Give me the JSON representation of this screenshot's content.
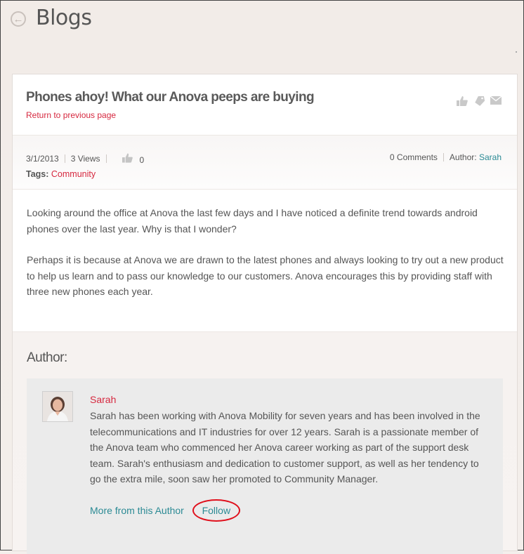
{
  "header": {
    "title": "Blogs"
  },
  "post": {
    "title": "Phones ahoy! What our Anova peeps are buying",
    "return_label": "Return to previous page",
    "date": "3/1/2013",
    "views": "3 Views",
    "likes": "0",
    "comments": "0 Comments",
    "author_label": "Author:",
    "author_name": "Sarah",
    "tags_label": "Tags:",
    "tag": "Community",
    "paragraphs": [
      "Looking around the office at Anova the last few days and I have noticed a definite trend towards android phones over the last year. Why is that I wonder?",
      "Perhaps it is because at Anova we are drawn to the latest phones and always looking to try out a new product to help us learn and to pass our knowledge to our customers. Anova encourages this by providing staff with three new phones each year."
    ]
  },
  "author_section": {
    "heading": "Author:",
    "name": "Sarah",
    "bio": "Sarah has been working with Anova Mobility for seven years and has been involved in the telecommunications and IT industries for over 12 years. Sarah is a passionate member of the Anova team who commenced her Anova career working as part of the support desk team. Sarah's enthusiasm and dedication to customer support, as well as her tendency to go the extra mile, soon saw her promoted to Community Manager.",
    "more_link": "More from this Author",
    "follow_link": "Follow"
  },
  "icons": [
    "back-arrow-icon",
    "thumbs-up-icon",
    "tag-icon",
    "mail-icon"
  ],
  "colors": {
    "link_red": "#d6283f",
    "link_teal": "#2b8a94",
    "highlight": "#e0101c"
  }
}
